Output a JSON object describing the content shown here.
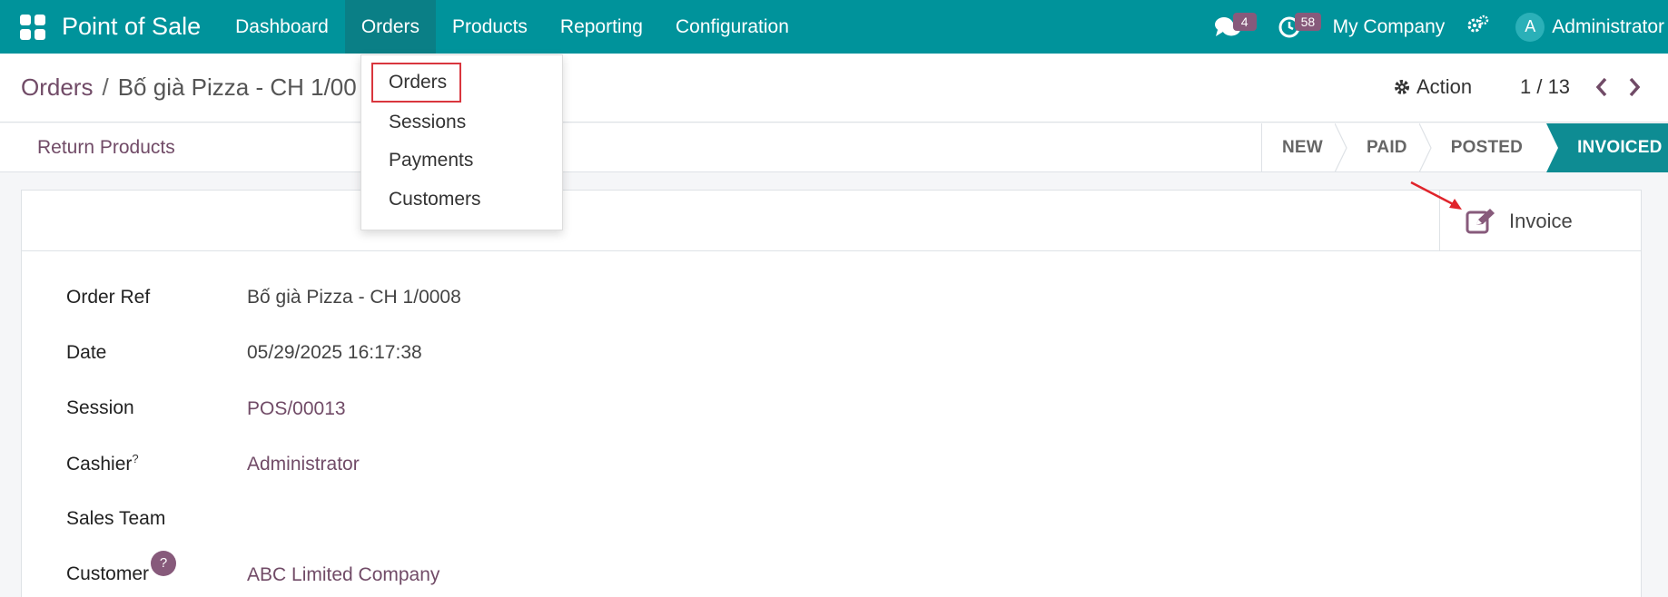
{
  "topbar": {
    "app_title": "Point of Sale",
    "menu": [
      "Dashboard",
      "Orders",
      "Products",
      "Reporting",
      "Configuration"
    ],
    "messages_count": "4",
    "activities_count": "58",
    "company": "My Company",
    "avatar_initial": "A",
    "user": "Administrator"
  },
  "breadcrumb": {
    "parent": "Orders",
    "separator": "/",
    "current": "Bố già Pizza - CH 1/00"
  },
  "control": {
    "action_label": "Action",
    "pager": "1 / 13"
  },
  "statusbar": {
    "return_label": "Return Products",
    "stages": [
      "NEW",
      "PAID",
      "POSTED",
      "INVOICED"
    ],
    "active_stage": "INVOICED"
  },
  "buttons": {
    "invoice_label": "Invoice"
  },
  "form": {
    "order_ref_label": "Order Ref",
    "order_ref_value": "Bố già Pizza - CH 1/0008",
    "date_label": "Date",
    "date_value": "05/29/2025 16:17:38",
    "session_label": "Session",
    "session_value": "POS/00013",
    "cashier_label": "Cashier",
    "cashier_help": "?",
    "cashier_value": "Administrator",
    "sales_team_label": "Sales Team",
    "customer_label": "Customer",
    "customer_help": "?",
    "customer_value": "ABC Limited Company"
  },
  "dropdown": {
    "items": [
      "Orders",
      "Sessions",
      "Payments",
      "Customers"
    ]
  },
  "colors": {
    "topbar": "#00939b",
    "accent": "#714b67",
    "badge": "#875a7b",
    "highlight": "#d9363e"
  }
}
